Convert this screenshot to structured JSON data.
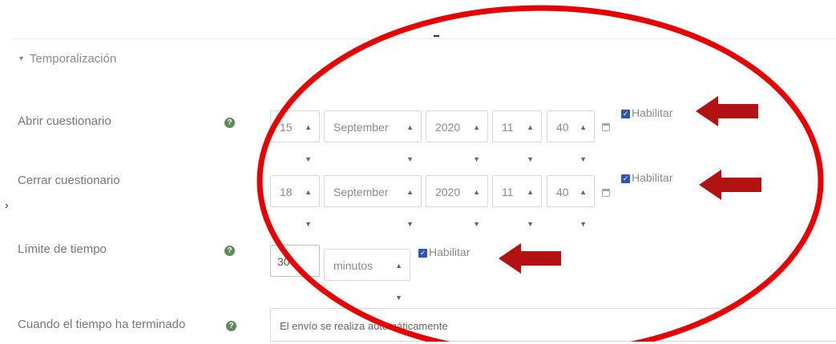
{
  "section": {
    "title": "Temporalización"
  },
  "fields": {
    "open_quiz": {
      "label": "Abrir cuestionario",
      "day": "15",
      "month": "September",
      "year": "2020",
      "hour": "11",
      "minute": "40",
      "enable_label": "Habilitar",
      "enabled": true
    },
    "close_quiz": {
      "label": "Cerrar cuestionario",
      "day": "18",
      "month": "September",
      "year": "2020",
      "hour": "11",
      "minute": "40",
      "enable_label": "Habilitar",
      "enabled": true
    },
    "time_limit": {
      "label": "Límite de tiempo",
      "value": "30",
      "unit": "minutos",
      "enable_label": "Habilitar",
      "enabled": true
    },
    "when_time_expires": {
      "label": "Cuando el tiempo ha terminado",
      "value": "El envío se realiza automáticamente"
    }
  },
  "icons": {
    "help": "question-circle-icon",
    "calendar": "calendar-icon",
    "select_arrow": "up-down-caret-icon",
    "checkbox": "checkbox-checked-icon",
    "annotation_arrow": "red-left-arrow"
  },
  "colors": {
    "annotation": "#e60000",
    "arrow": "#b31212",
    "checkbox": "#2c55b5",
    "help_icon": "#5f8a5a"
  }
}
